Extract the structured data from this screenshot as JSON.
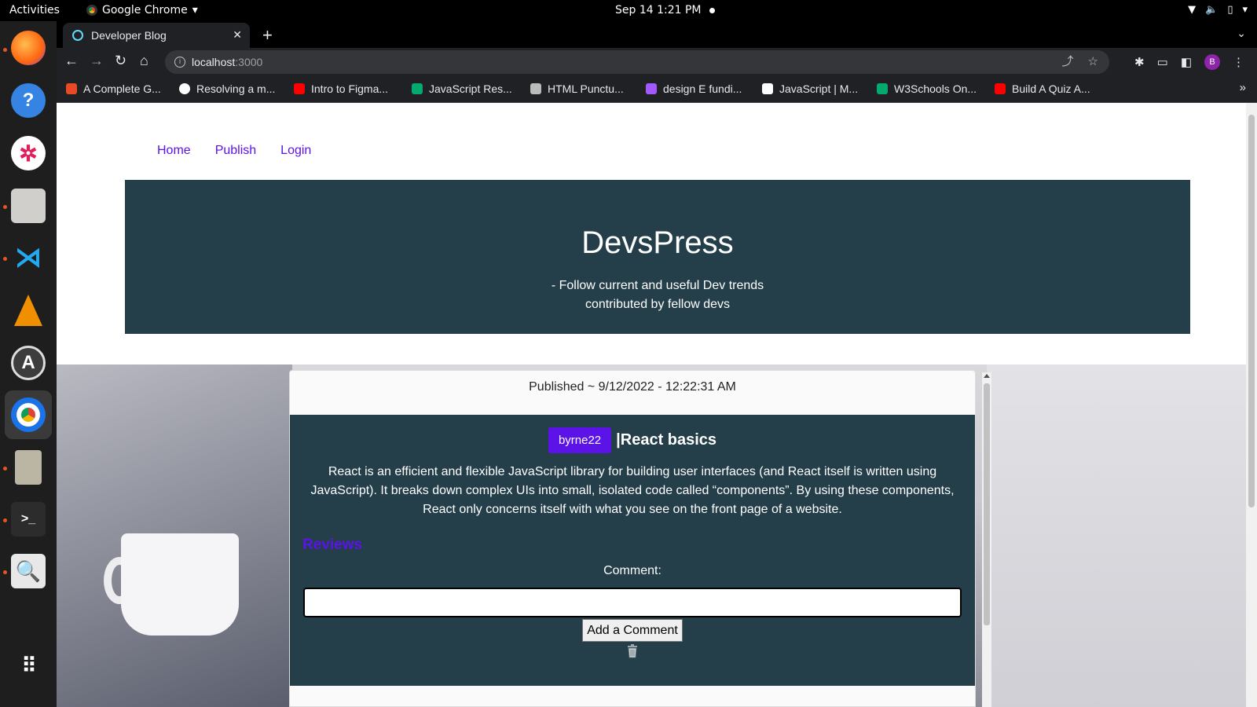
{
  "system": {
    "activities": "Activities",
    "app_name": "Google Chrome",
    "datetime": "Sep 14  1:21 PM"
  },
  "dock": {
    "items": [
      "firefox-icon",
      "help-icon",
      "slack-icon",
      "files-icon",
      "vscode-icon",
      "vlc-icon",
      "software-icon",
      "chrome-icon",
      "archive-icon",
      "terminal-icon",
      "search-app-icon",
      "app-grid-icon"
    ]
  },
  "browser": {
    "tab_title": "Developer Blog",
    "url_host": "localhost",
    "url_port": ":3000",
    "profile_initial": "B",
    "bookmarks": [
      {
        "label": "A Complete G...",
        "color": "#e84a27"
      },
      {
        "label": "Resolving a m...",
        "color": "#ffffff"
      },
      {
        "label": "Intro to Figma...",
        "color": "#ff0000"
      },
      {
        "label": "JavaScript Res...",
        "color": "#04aa6d"
      },
      {
        "label": "HTML Punctu...",
        "color": "#bbbbbb"
      },
      {
        "label": "design E fundi...",
        "color": "#a259ff"
      },
      {
        "label": "JavaScript | M...",
        "color": "#ffffff"
      },
      {
        "label": "W3Schools On...",
        "color": "#04aa6d"
      },
      {
        "label": "Build A Quiz A...",
        "color": "#ff0000"
      }
    ]
  },
  "page": {
    "nav": [
      "Home",
      "Publish",
      "Login"
    ],
    "hero_title": "DevsPress",
    "hero_line1": "- Follow current and useful Dev trends",
    "hero_line2": "contributed by fellow devs",
    "post": {
      "published": "Published ~ 9/12/2022 - 12:22:31 AM",
      "author": "byrne22",
      "title": "|React basics",
      "body": "React is an efficient and flexible JavaScript library for building user interfaces (and React itself is written using JavaScript). It breaks down complex UIs into small, isolated code called “components”. By using these components, React only concerns itself with what you see on the front page of a website.",
      "reviews_label": "Reviews",
      "comment_label": "Comment:",
      "comment_value": "",
      "add_button": "Add a Comment"
    },
    "colors": {
      "accent": "#5b13e8",
      "hero_bg": "#243f4a"
    }
  }
}
